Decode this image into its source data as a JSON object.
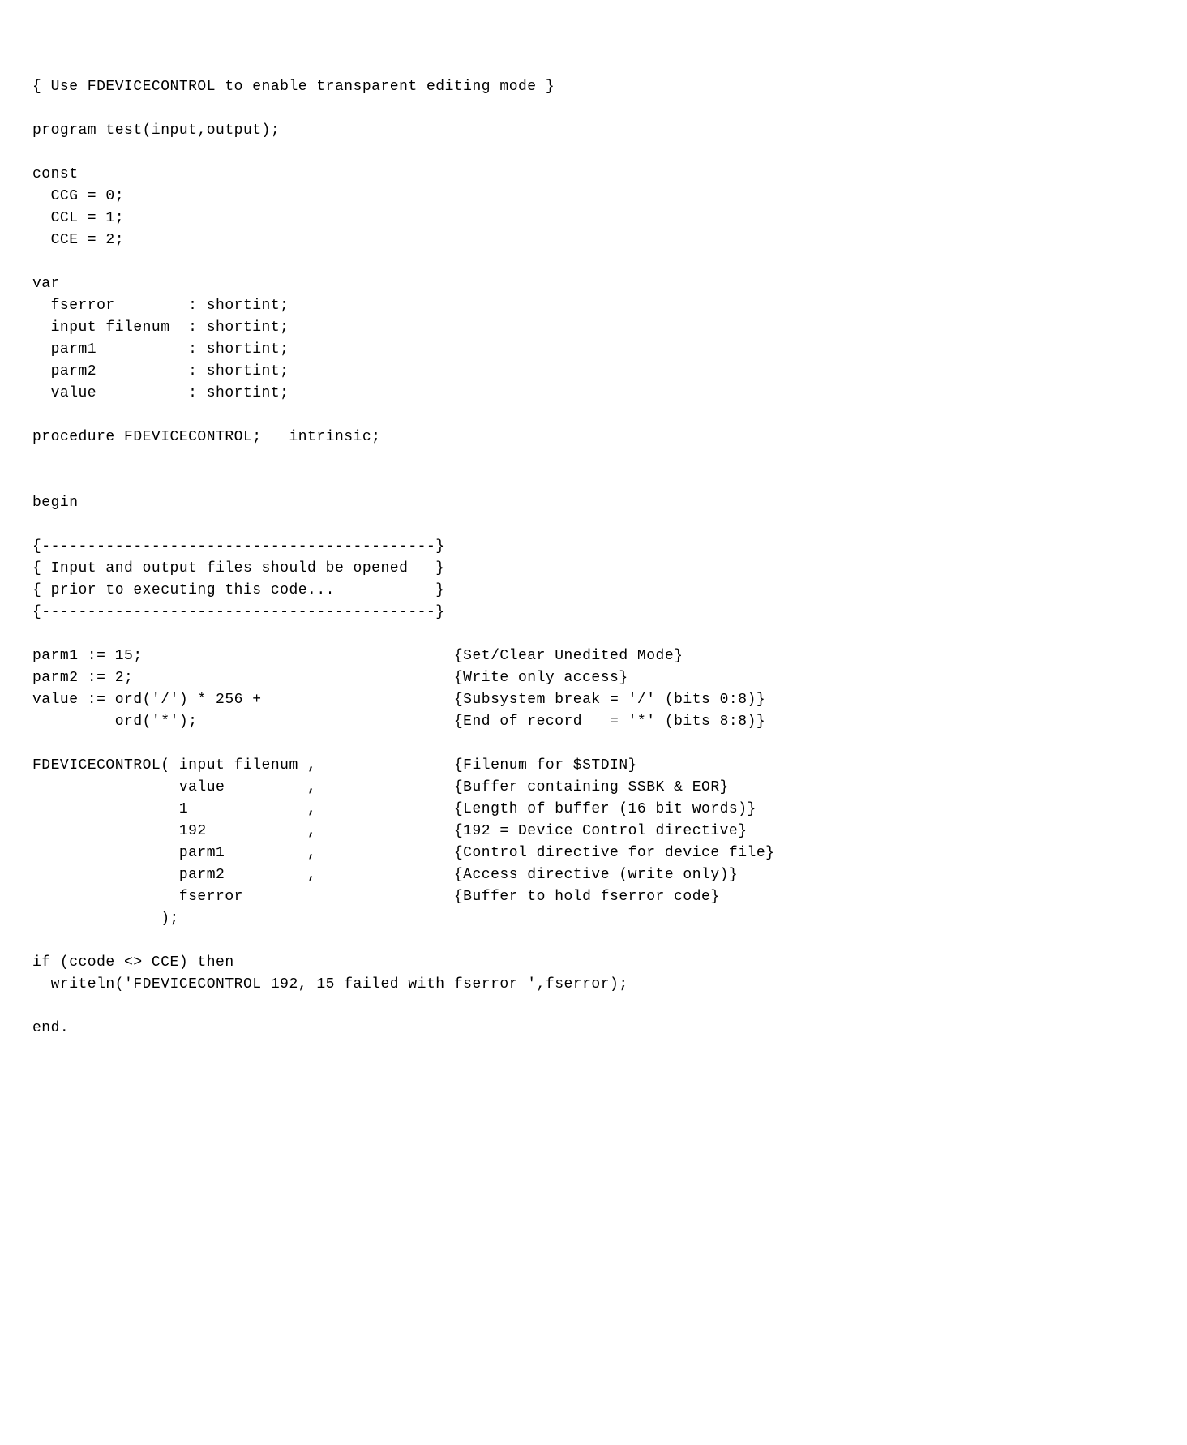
{
  "lines": [
    "{ Use FDEVICECONTROL to enable transparent editing mode }",
    "",
    "program test(input,output);",
    "",
    "const",
    "  CCG = 0;",
    "  CCL = 1;",
    "  CCE = 2;",
    "",
    "var",
    "  fserror        : shortint;",
    "  input_filenum  : shortint;",
    "  parm1          : shortint;",
    "  parm2          : shortint;",
    "  value          : shortint;",
    "",
    "procedure FDEVICECONTROL;   intrinsic;",
    "",
    "",
    "begin",
    "",
    "{-------------------------------------------}",
    "{ Input and output files should be opened   }",
    "{ prior to executing this code...           }",
    "{-------------------------------------------}",
    "",
    "parm1 := 15;                                  {Set/Clear Unedited Mode}",
    "parm2 := 2;                                   {Write only access}",
    "value := ord('/') * 256 +                     {Subsystem break = '/' (bits 0:8)}",
    "         ord('*');                            {End of record   = '*' (bits 8:8)}",
    "",
    "FDEVICECONTROL( input_filenum ,               {Filenum for $STDIN}",
    "                value         ,               {Buffer containing SSBK & EOR}",
    "                1             ,               {Length of buffer (16 bit words)}",
    "                192           ,               {192 = Device Control directive}",
    "                parm1         ,               {Control directive for device file}",
    "                parm2         ,               {Access directive (write only)}",
    "                fserror                       {Buffer to hold fserror code}",
    "              );",
    "",
    "if (ccode <> CCE) then",
    "  writeln('FDEVICECONTROL 192, 15 failed with fserror ',fserror);",
    "",
    "end."
  ]
}
